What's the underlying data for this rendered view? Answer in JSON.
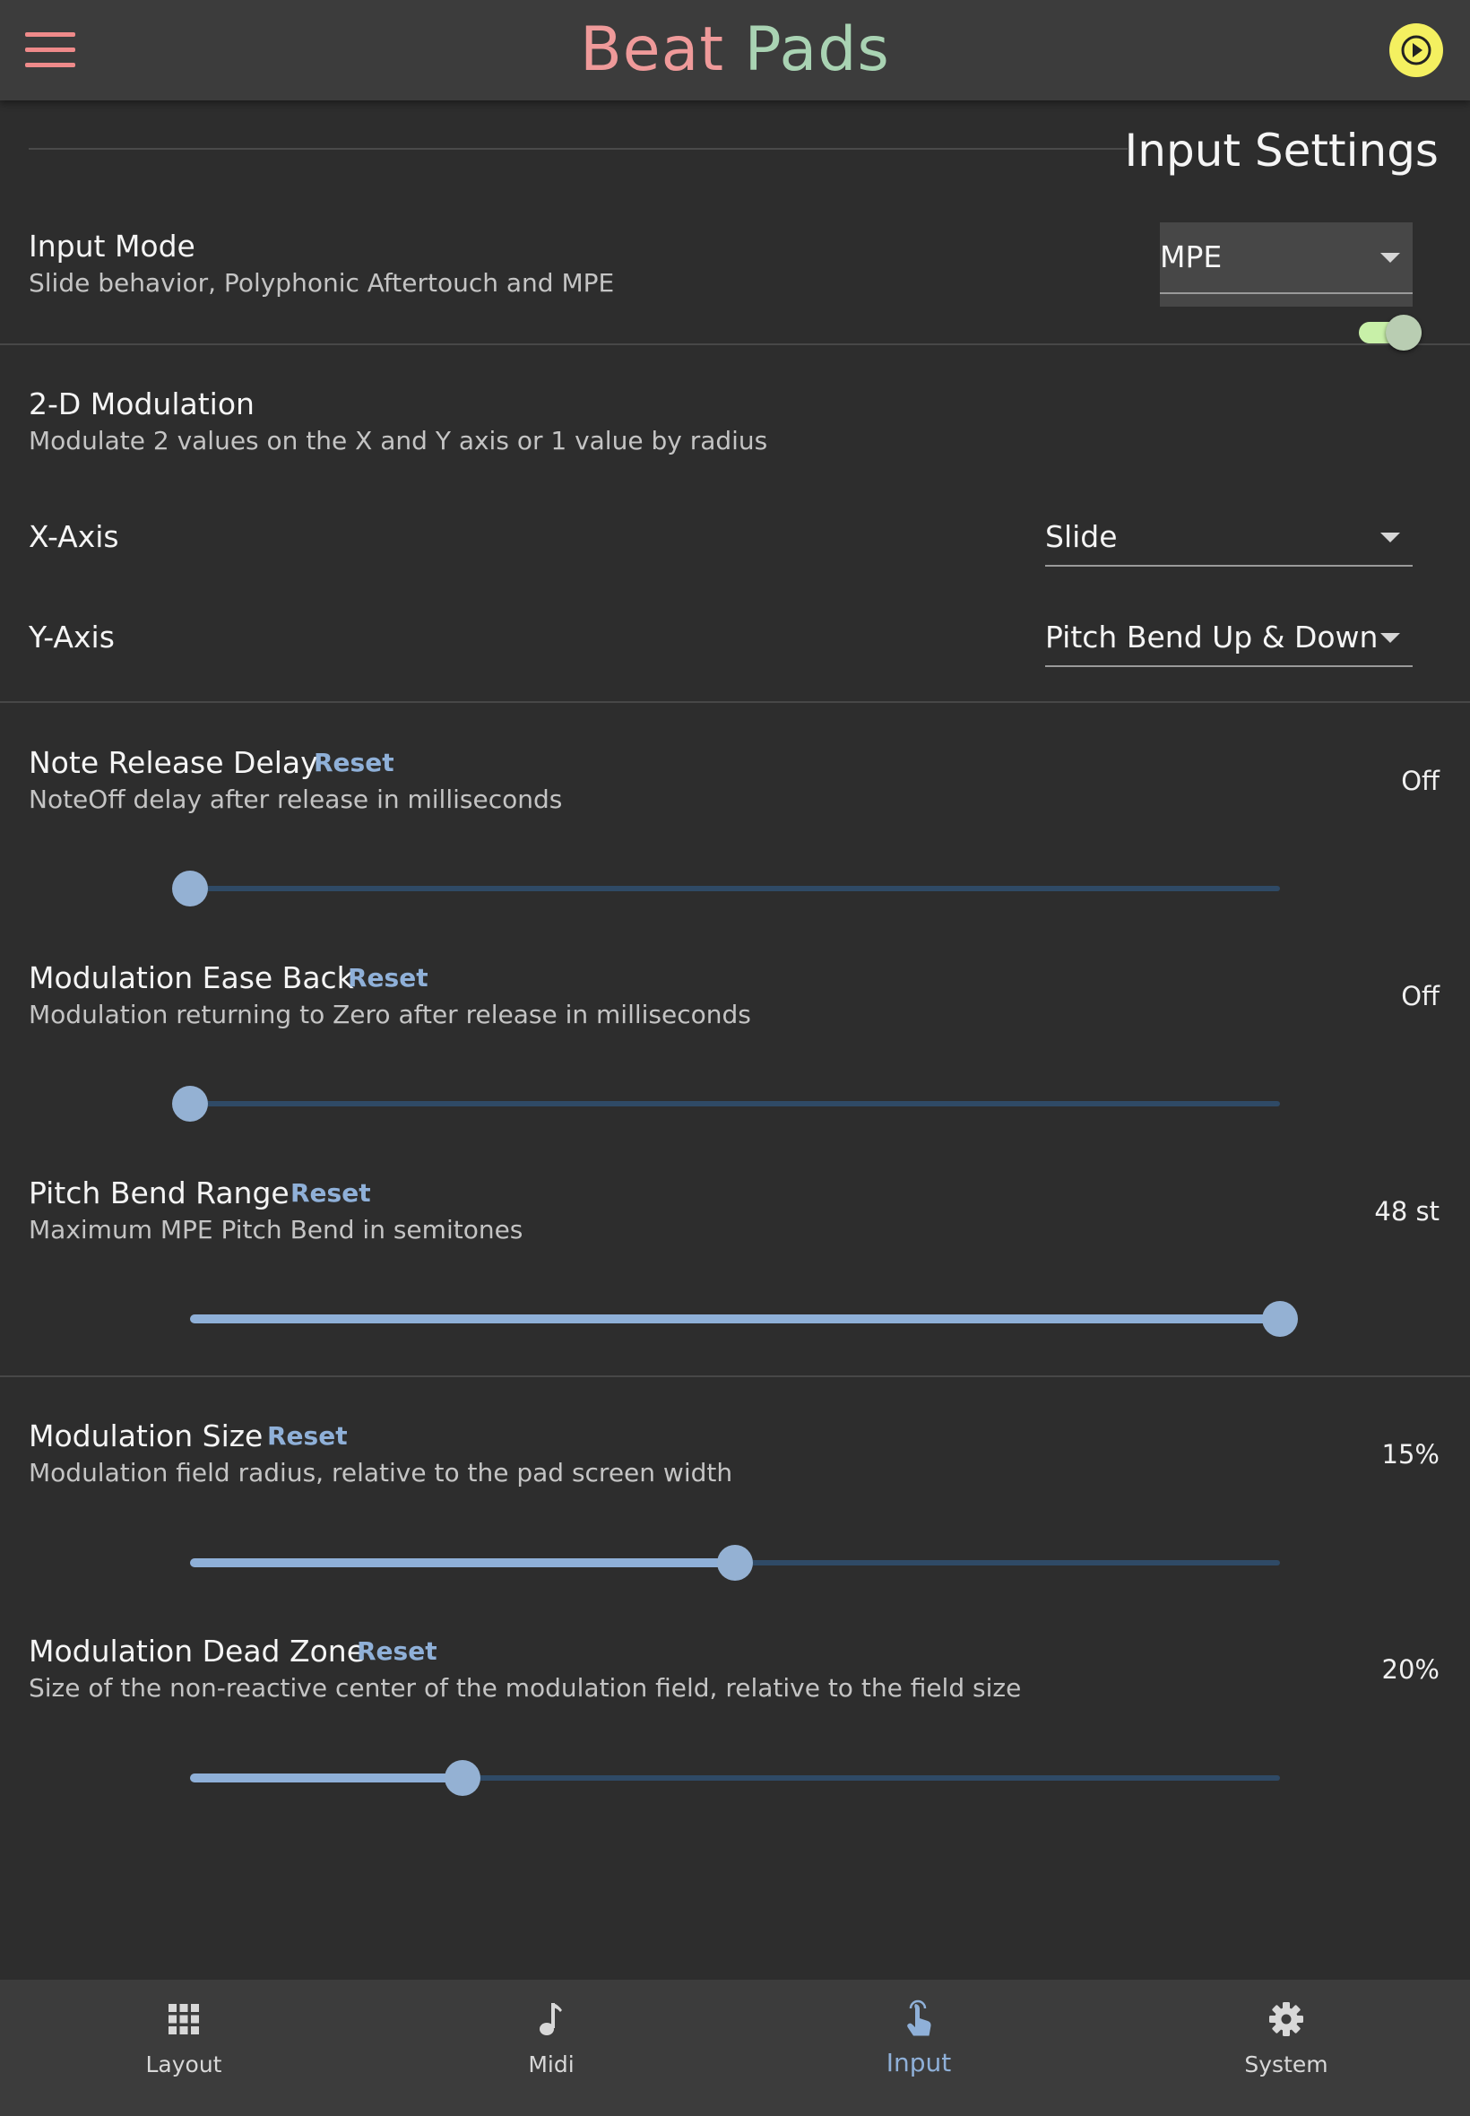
{
  "header": {
    "title_part1": "Beat",
    "title_part2": "Pads"
  },
  "page_title": "Input Settings",
  "input_mode": {
    "label": "Input Mode",
    "description": "Slide behavior, Polyphonic Aftertouch and MPE",
    "selected": "MPE"
  },
  "modulation_2d": {
    "label": "2-D Modulation",
    "description": "Modulate 2 values on the X and Y axis or 1 value by radius",
    "enabled": true
  },
  "x_axis": {
    "label": "X-Axis",
    "selected": "Slide"
  },
  "y_axis": {
    "label": "Y-Axis",
    "selected": "Pitch Bend Up & Down"
  },
  "reset_label": "Reset",
  "sliders": [
    {
      "label": "Note Release Delay",
      "description": "NoteOff delay after release in milliseconds",
      "value_text": "Off",
      "fraction": 0
    },
    {
      "label": "Modulation Ease Back",
      "description": "Modulation returning to Zero after release in milliseconds",
      "value_text": "Off",
      "fraction": 0
    },
    {
      "label": "Pitch Bend Range",
      "description": "Maximum MPE Pitch Bend in semitones",
      "value_text": "48 st",
      "fraction": 1.0
    },
    {
      "label": "Modulation Size",
      "description": "Modulation field radius, relative to the pad screen width",
      "value_text": "15%",
      "fraction": 0.5
    },
    {
      "label": "Modulation Dead Zone",
      "description": "Size of the non-reactive center of the modulation field, relative to the field size",
      "value_text": "20%",
      "fraction": 0.25
    }
  ],
  "bottom_nav": [
    {
      "label": "Layout",
      "icon": "grid-icon"
    },
    {
      "label": "Midi",
      "icon": "music-note-icon"
    },
    {
      "label": "Input",
      "icon": "touch-icon",
      "active": true
    },
    {
      "label": "System",
      "icon": "gear-icon"
    }
  ],
  "colors": {
    "accent": "#8fb0d8",
    "title_red": "#ef9a9a",
    "title_green": "#a9d3b3",
    "play_yellow": "#f4f060",
    "toggle_track": "#c8f0a8"
  }
}
